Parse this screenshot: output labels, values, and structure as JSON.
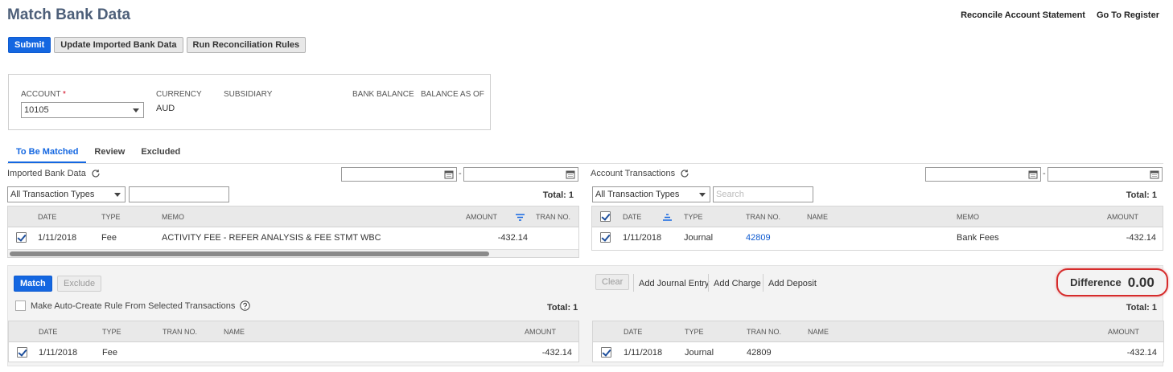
{
  "page": {
    "title": "Match Bank Data"
  },
  "top_links": {
    "reconcile": "Reconcile Account Statement",
    "register": "Go To Register"
  },
  "toolbar": {
    "submit": "Submit",
    "update": "Update Imported Bank Data",
    "run_rules": "Run Reconciliation Rules"
  },
  "account": {
    "account_label": "ACCOUNT",
    "required_mark": "*",
    "account_value": "10105",
    "currency_label": "CURRENCY",
    "currency_value": "AUD",
    "subsidiary_label": "SUBSIDIARY",
    "bank_balance_label": "BANK BALANCE",
    "balance_as_of_label": "BALANCE AS OF"
  },
  "tabs": [
    {
      "label": "To Be Matched",
      "active": true
    },
    {
      "label": "Review",
      "active": false
    },
    {
      "label": "Excluded",
      "active": false
    }
  ],
  "imported": {
    "header": "Imported Bank Data",
    "date_sep": "-",
    "filter": "All Transaction Types",
    "total": "Total: 1",
    "columns": {
      "date": "DATE",
      "type": "TYPE",
      "memo": "MEMO",
      "amount": "AMOUNT",
      "tran_no": "TRAN NO."
    },
    "row": {
      "date": "1/11/2018",
      "type": "Fee",
      "memo": "ACTIVITY FEE - REFER ANALYSIS & FEE STMT WBC",
      "amount": "-432.14",
      "tran_no": ""
    }
  },
  "account_tx": {
    "header": "Account Transactions",
    "date_sep": "-",
    "filter": "All Transaction Types",
    "search_placeholder": "Search",
    "total": "Total: 1",
    "columns": {
      "date": "DATE",
      "type": "TYPE",
      "tran_no": "TRAN NO.",
      "name": "NAME",
      "memo": "MEMO",
      "amount": "AMOUNT"
    },
    "row": {
      "date": "1/11/2018",
      "type": "Journal",
      "tran_no": "42809",
      "name": "",
      "memo": "Bank Fees",
      "amount": "-432.14"
    }
  },
  "match": {
    "match_label": "Match",
    "exclude_label": "Exclude",
    "clear_label": "Clear",
    "add_journal": "Add Journal Entry",
    "add_charge": "Add Charge",
    "add_deposit": "Add Deposit",
    "auto_create": "Make Auto-Create Rule From Selected Transactions",
    "total_left": "Total: 1",
    "total_right": "Total: 1",
    "difference_label": "Difference",
    "difference_value": "0.00"
  },
  "selected_bank": {
    "columns": {
      "date": "DATE",
      "type": "TYPE",
      "tran_no": "TRAN NO.",
      "name": "NAME",
      "amount": "AMOUNT"
    },
    "row": {
      "date": "1/11/2018",
      "type": "Fee",
      "tran_no": "",
      "name": "",
      "amount": "-432.14"
    }
  },
  "selected_account": {
    "columns": {
      "date": "DATE",
      "type": "TYPE",
      "tran_no": "TRAN NO.",
      "name": "NAME",
      "amount": "AMOUNT"
    },
    "row": {
      "date": "1/11/2018",
      "type": "Journal",
      "tran_no": "42809",
      "name": "",
      "amount": "-432.14"
    }
  }
}
